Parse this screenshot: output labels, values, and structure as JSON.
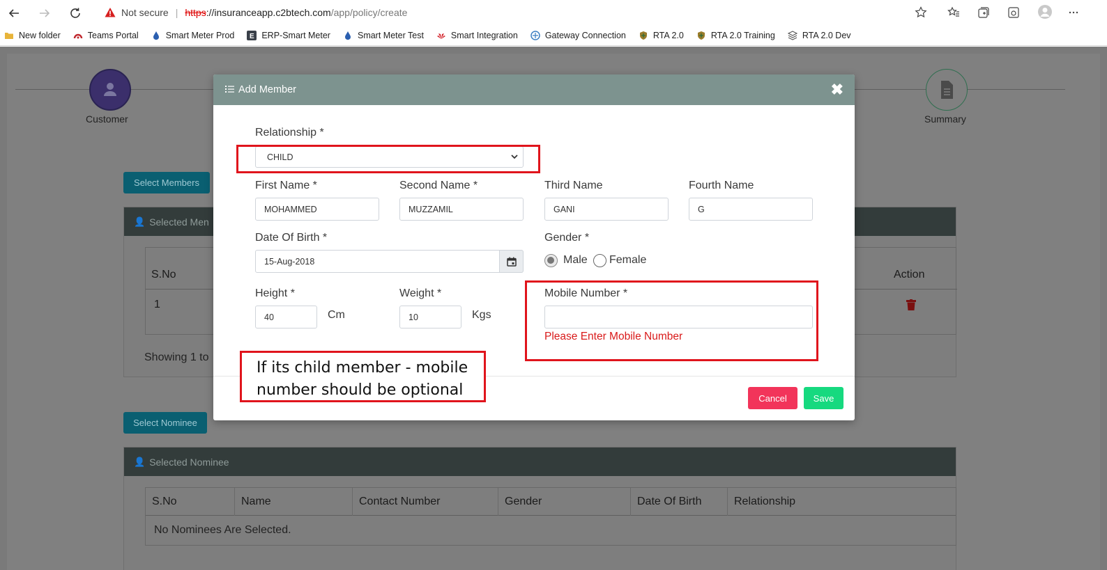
{
  "browser": {
    "security_label": "Not secure",
    "url_scheme": "https",
    "url_host": "://insuranceapp.c2btech.com",
    "url_path": "/app/policy/create",
    "bookmarks": [
      {
        "label": "New folder",
        "icon": "folder-icon"
      },
      {
        "label": "Teams Portal",
        "icon": "teams-portal-icon"
      },
      {
        "label": "Smart Meter Prod",
        "icon": "drop-icon"
      },
      {
        "label": "ERP-Smart Meter",
        "icon": "erp-icon"
      },
      {
        "label": "Smart Meter Test",
        "icon": "drop-icon"
      },
      {
        "label": "Smart Integration",
        "icon": "huawei-icon"
      },
      {
        "label": "Gateway Connection",
        "icon": "gateway-icon"
      },
      {
        "label": "RTA 2.0",
        "icon": "crest-icon"
      },
      {
        "label": "RTA 2.0 Training",
        "icon": "crest-icon"
      },
      {
        "label": "RTA 2.0 Dev",
        "icon": "layers-icon"
      }
    ]
  },
  "stepper": {
    "first_label": "Customer",
    "last_label": "Summary"
  },
  "background": {
    "select_members_label": "Select Members",
    "selected_members_title": "Selected Men",
    "members_table": {
      "col_sno": "S.No",
      "col_action": "Action",
      "row_sno": "1"
    },
    "showing_text": "Showing 1 to",
    "select_nominee_label": "Select Nominee",
    "selected_nominee_title": "Selected Nominee",
    "nominee_columns": [
      "S.No",
      "Name",
      "Contact Number",
      "Gender",
      "Date Of Birth",
      "Relationship"
    ],
    "no_nominees_text": "No Nominees Are Selected."
  },
  "modal": {
    "title": "Add Member",
    "relationship_label": "Relationship *",
    "relationship_value": "CHILD",
    "first_name_label": "First Name *",
    "first_name_value": "MOHAMMED",
    "second_name_label": "Second Name *",
    "second_name_value": "MUZZAMIL",
    "third_name_label": "Third Name",
    "third_name_value": "GANI",
    "fourth_name_label": "Fourth Name",
    "fourth_name_value": "G",
    "dob_label": "Date Of Birth *",
    "dob_value": "15-Aug-2018",
    "gender_label": "Gender *",
    "gender_male": "Male",
    "gender_female": "Female",
    "gender_selected": "Male",
    "height_label": "Height *",
    "height_value": "40",
    "height_unit": "Cm",
    "weight_label": "Weight *",
    "weight_value": "10",
    "weight_unit": "Kgs",
    "mobile_label": "Mobile Number *",
    "mobile_value": "",
    "mobile_error": "Please Enter Mobile Number",
    "cancel_label": "Cancel",
    "save_label": "Save"
  },
  "annotation": {
    "note_line1": "If its child member - mobile",
    "note_line2": "number should be optional",
    "color": "#e0141c"
  },
  "colors": {
    "modal_header": "#7d938f",
    "cancel": "#f2345a",
    "save": "#16d97f",
    "error": "#d91a1a"
  }
}
